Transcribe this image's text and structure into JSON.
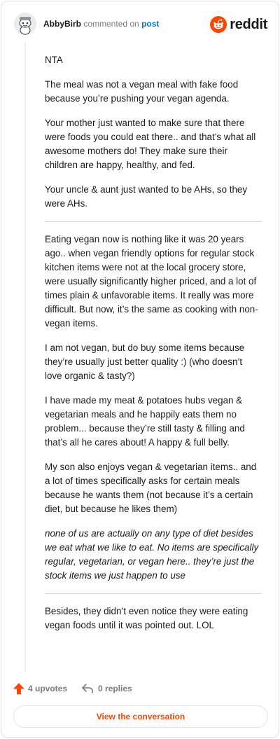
{
  "header": {
    "username": "AbbyBirb",
    "action_text": "commented on",
    "post_link": "post",
    "brand_name": "reddit"
  },
  "comment": {
    "p1": "NTA",
    "p2": "The meal was not a vegan meal with fake food because you’re pushing your vegan agenda.",
    "p3": "Your mother just wanted to make sure that there were foods you could eat there.. and that’s what all awesome mothers do! They make sure their children are happy, healthy, and fed.",
    "p4": "Your uncle & aunt just wanted to be AHs, so they were AHs.",
    "p5": "Eating vegan now is nothing like it was 20 years ago.. when vegan friendly options for regular stock kitchen items were not at the local grocery store, were usually significantly higher priced, and a lot of times plain & unfavorable items. It really was more difficult. But now, it’s the same as cooking with non-vegan items.",
    "p6": "I am not vegan, but do buy some items because they’re usually just better quality :) (who doesn’t love organic & tasty?)",
    "p7": "I have made my meat & potatoes hubs vegan & vegetarian meals and he happily eats them no problem... because they’re still tasty & filling and that’s all he cares about! A happy & full belly.",
    "p8": "My son also enjoys vegan & vegetarian items.. and a lot of times specifically asks for certain meals because he wants them (not because it’s a certain diet, but because he likes them)",
    "p9": "none of us are actually on any type of diet besides we eat what we like to eat. No items are specifically regular, vegetarian, or vegan here.. they’re just the stock items we just happen to use",
    "p10": "Besides, they didn’t even notice they were eating vegan foods until it was pointed out. LOL"
  },
  "actions": {
    "upvotes": "4 upvotes",
    "replies": "0 replies",
    "view_button": "View the conversation"
  },
  "colors": {
    "accent": "#ff4500",
    "link": "#0079d3",
    "muted": "#7c7c7c"
  },
  "icons": [
    "avatar-snoo-icon",
    "reddit-logo-icon",
    "upvote-arrow-icon",
    "reply-icon"
  ]
}
